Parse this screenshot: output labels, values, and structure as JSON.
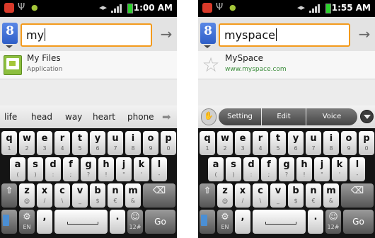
{
  "phones": [
    {
      "status": {
        "time": "1:00 AM"
      },
      "query": "my",
      "suggestion": {
        "title": "My Files",
        "subtitle": "Application",
        "icon": "my-files-app-icon"
      },
      "wordbar": {
        "words": [
          "life",
          "head",
          "way",
          "heart",
          "phone"
        ],
        "arrow_icon": "arrow-right-icon"
      },
      "go_label": "Go"
    },
    {
      "status": {
        "time": "1:55 AM"
      },
      "query": "myspace",
      "suggestion": {
        "title": "MySpace",
        "subtitle": "www.myspace.com",
        "icon": "star-icon"
      },
      "toolbar": {
        "buttons": [
          "Setting",
          "Edit",
          "Voice"
        ]
      },
      "go_label": "Go"
    }
  ],
  "keyboard": {
    "rows": [
      [
        {
          "main": "q",
          "sub": "1"
        },
        {
          "main": "w",
          "sub": "2"
        },
        {
          "main": "e",
          "sub": "3"
        },
        {
          "main": "r",
          "sub": "4"
        },
        {
          "main": "t",
          "sub": "5"
        },
        {
          "main": "y",
          "sub": "6"
        },
        {
          "main": "u",
          "sub": "7"
        },
        {
          "main": "i",
          "sub": "8"
        },
        {
          "main": "o",
          "sub": "9"
        },
        {
          "main": "p",
          "sub": "0"
        }
      ],
      [
        {
          "main": "a",
          "sub": "("
        },
        {
          "main": "s",
          "sub": ")"
        },
        {
          "main": "d",
          "sub": ":"
        },
        {
          "main": "f",
          "sub": ";"
        },
        {
          "main": "g",
          "sub": "?"
        },
        {
          "main": "h",
          "sub": "!"
        },
        {
          "main": "j",
          "sub": "\""
        },
        {
          "main": "k",
          "sub": "'"
        },
        {
          "main": "l",
          "sub": "-"
        }
      ],
      [
        {
          "main": "⇧",
          "sub": "",
          "kind": "shift"
        },
        {
          "main": "z",
          "sub": "@"
        },
        {
          "main": "x",
          "sub": "/"
        },
        {
          "main": "c",
          "sub": "\\"
        },
        {
          "main": "v",
          "sub": "_"
        },
        {
          "main": "b",
          "sub": "$"
        },
        {
          "main": "n",
          "sub": "€"
        },
        {
          "main": "m",
          "sub": "&"
        },
        {
          "main": "⌫",
          "sub": "",
          "kind": "backspace"
        }
      ],
      [
        {
          "main": "",
          "sub": "",
          "kind": "voice"
        },
        {
          "main": "⚙",
          "sub": "EN",
          "kind": "settings"
        },
        {
          "main": ",",
          "sub": "",
          "kind": "comma"
        },
        {
          "main": "",
          "sub": "",
          "kind": "space"
        },
        {
          "main": ".",
          "sub": "",
          "kind": "period"
        },
        {
          "main": "☺",
          "sub": "12#",
          "kind": "emoji"
        },
        {
          "main": "Go",
          "sub": "",
          "kind": "go"
        }
      ]
    ]
  },
  "colors": {
    "accent_focus": "#f39a1c",
    "status_bar": "#000000",
    "battery": "#2bd12b",
    "url_green": "#3a8c3a"
  }
}
